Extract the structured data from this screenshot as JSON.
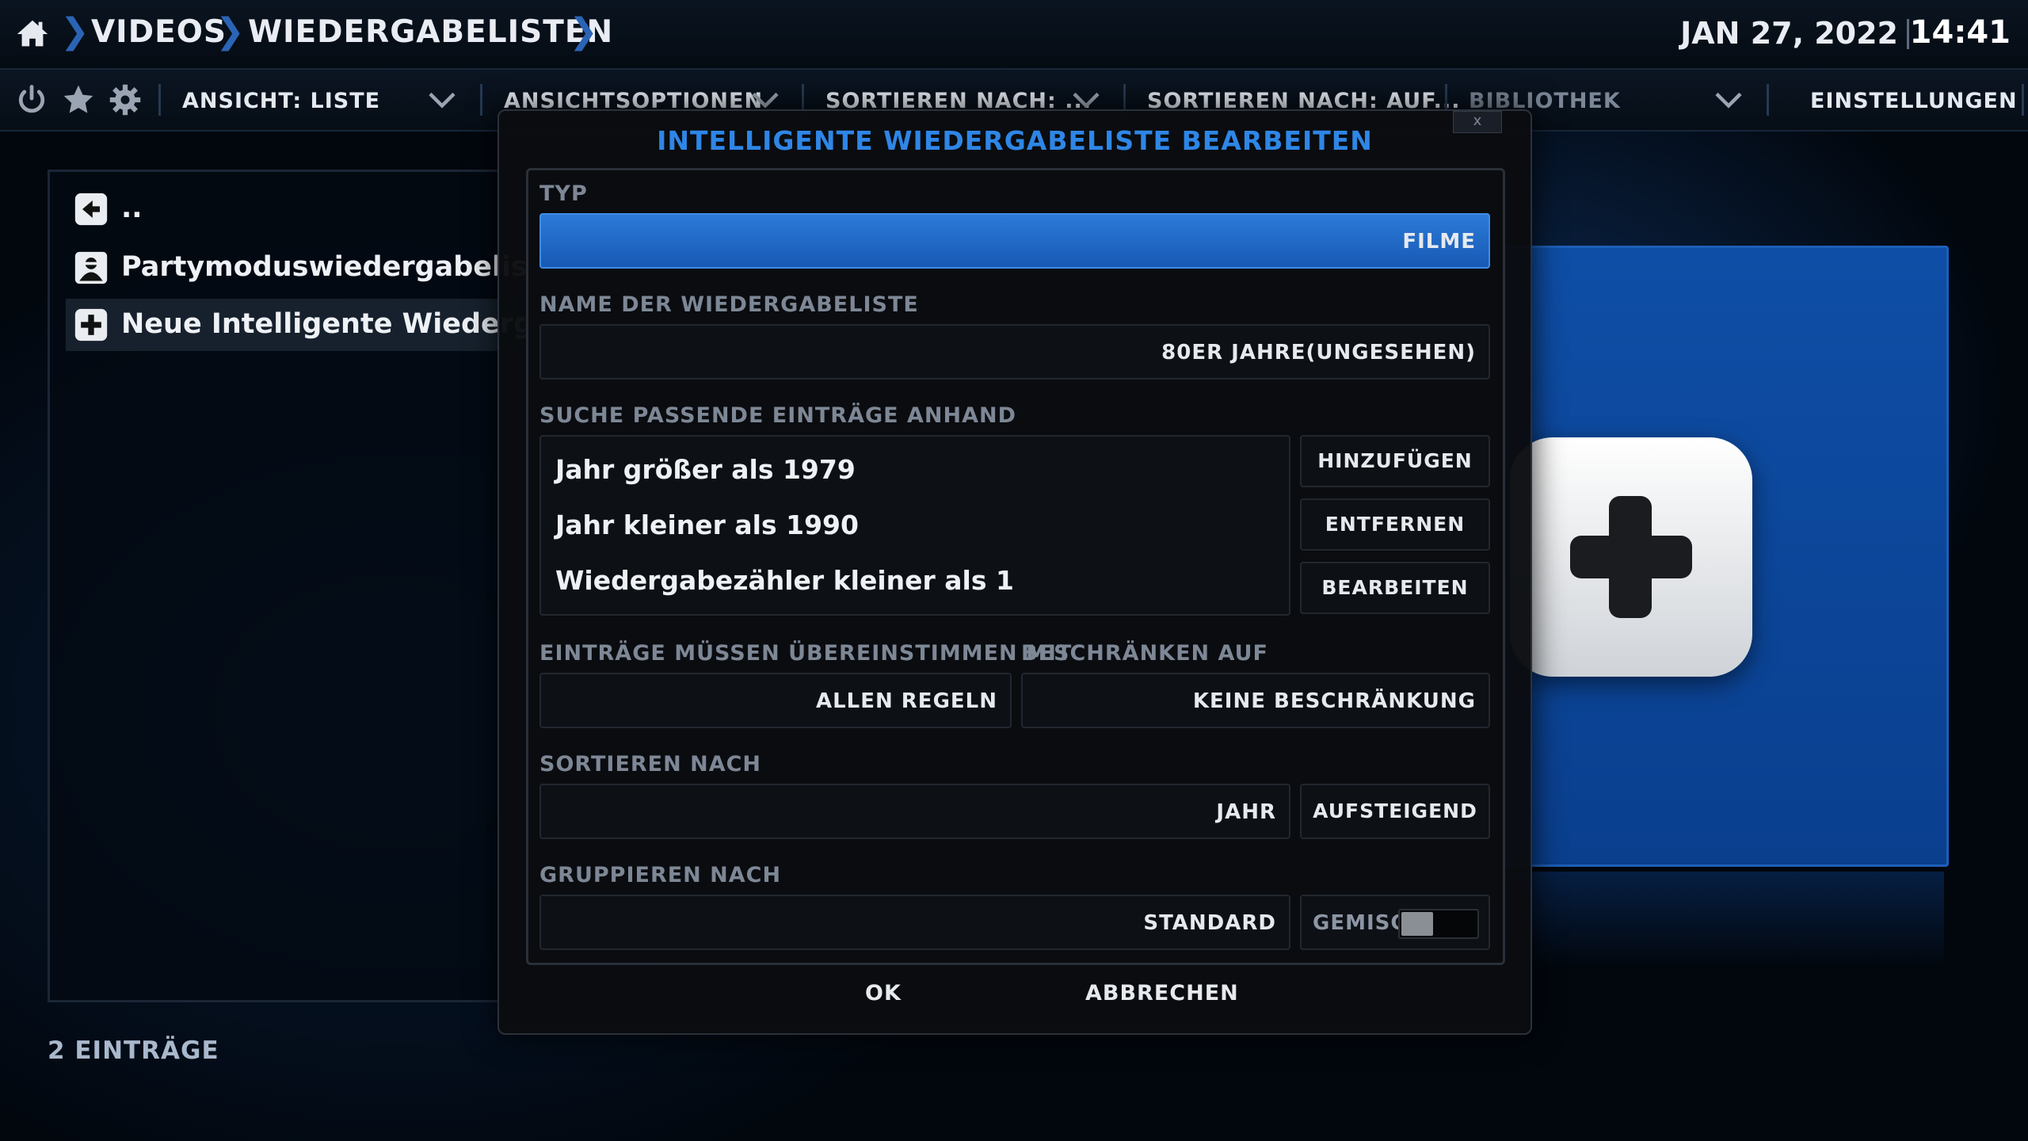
{
  "breadcrumb": {
    "items": [
      "VIDEOS",
      "WIEDERGABELISTEN"
    ]
  },
  "clock": {
    "date": "JAN 27, 2022",
    "time": "14:41"
  },
  "toolbar": {
    "view_label": "ANSICHT: LISTE",
    "view_options_label": "ANSICHTSOPTIONEN",
    "sort_by_label": "SORTIEREN NACH: ...",
    "sort_dir_label": "SORTIEREN NACH: AUF...",
    "library_label": "BIBLIOTHEK",
    "settings_label": "EINSTELLUNGEN"
  },
  "list": {
    "items": [
      {
        "label": "..",
        "icon": "back-icon"
      },
      {
        "label": "Partymoduswiedergabeliste",
        "icon": "party-icon"
      },
      {
        "label": "Neue Intelligente Wiedergabeliste...",
        "icon": "plus-icon"
      }
    ],
    "count": "2 EINTRÄGE"
  },
  "dialog": {
    "title": "INTELLIGENTE WIEDERGABELISTE BEARBEITEN",
    "close_label": "x",
    "type_label": "TYP",
    "type_value": "FILME",
    "name_label": "NAME DER WIEDERGABELISTE",
    "name_value": "80ER JAHRE(UNGESEHEN)",
    "rules_label": "SUCHE PASSENDE EINTRÄGE ANHAND",
    "rules": [
      "Jahr größer als 1979",
      "Jahr kleiner als 1990",
      "Wiedergabezähler kleiner als 1"
    ],
    "add_label": "HINZUFÜGEN",
    "remove_label": "ENTFERNEN",
    "edit_label": "BEARBEITEN",
    "match_label": "EINTRÄGE MÜSSEN ÜBEREINSTIMMEN MIT",
    "match_value": "ALLEN REGELN",
    "limit_label": "BESCHRÄNKEN AUF",
    "limit_value": "KEINE BESCHRÄNKUNG",
    "sort_label": "SORTIEREN NACH",
    "sort_value": "JAHR",
    "sort_order": "AUFSTEIGEND",
    "group_label": "GRUPPIEREN NACH",
    "group_value": "STANDARD",
    "mixed_label": "GEMISCHT",
    "mixed_enabled": false,
    "ok_label": "OK",
    "cancel_label": "ABBRECHEN"
  },
  "colors": {
    "accent": "#2e86e6",
    "selection": "#1759b4",
    "crumb_sep": "#2b64b5"
  }
}
